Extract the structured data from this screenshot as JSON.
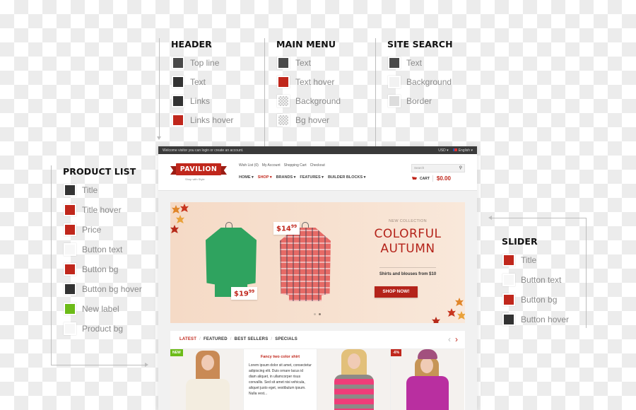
{
  "legends": {
    "header": {
      "title": "HEADER",
      "items": [
        {
          "label": "Top line",
          "color": "#4a4a4a"
        },
        {
          "label": "Text",
          "color": "#333333"
        },
        {
          "label": "Links",
          "color": "#333333"
        },
        {
          "label": "Links hover",
          "color": "#c0271c"
        }
      ]
    },
    "main_menu": {
      "title": "MAIN MENU",
      "items": [
        {
          "label": "Text",
          "color": "#4a4a4a"
        },
        {
          "label": "Text hover",
          "color": "#c0271c"
        },
        {
          "label": "Background",
          "color": "transparent"
        },
        {
          "label": "Bg hover",
          "color": "transparent"
        }
      ]
    },
    "site_search": {
      "title": "SITE SEARCH",
      "items": [
        {
          "label": "Text",
          "color": "#4a4a4a"
        },
        {
          "label": "Background",
          "color": "#f2f2f2"
        },
        {
          "label": "Border",
          "color": "#dddddd"
        }
      ]
    },
    "product_list": {
      "title": "PRODUCT LIST",
      "items": [
        {
          "label": "Title",
          "color": "#333333"
        },
        {
          "label": "Title hover",
          "color": "#c0271c"
        },
        {
          "label": "Price",
          "color": "#c0271c"
        },
        {
          "label": "Button text",
          "color": "#f7f7f7"
        },
        {
          "label": "Button bg",
          "color": "#c0271c"
        },
        {
          "label": "Button bg hover",
          "color": "#333333"
        },
        {
          "label": "New label",
          "color": "#6cbb18"
        },
        {
          "label": "Product bg",
          "color": "#f7f7f7"
        }
      ]
    },
    "slider": {
      "title": "SLIDER",
      "items": [
        {
          "label": "Title",
          "color": "#c0271c"
        },
        {
          "label": "Button text",
          "color": "#f7f7f7"
        },
        {
          "label": "Button bg",
          "color": "#c0271c"
        },
        {
          "label": "Button hover",
          "color": "#333333"
        }
      ]
    }
  },
  "site": {
    "topbar": {
      "welcome": "Welcome visitor you can login or create an account.",
      "currency": "USD ▾",
      "language": "English ▾"
    },
    "logo": {
      "name": "PAVILION",
      "tagline": "Shop with Style"
    },
    "toplinks": [
      "Wish List (0)",
      "My Account",
      "Shopping Cart",
      "Checkout"
    ],
    "menu": [
      {
        "label": "HOME ▾",
        "active": false
      },
      {
        "label": "SHOP ▾",
        "active": true
      },
      {
        "label": "BRANDS ▾",
        "active": false
      },
      {
        "label": "FEATURES ▾",
        "active": false
      },
      {
        "label": "BUILDER BLOCKS ▾",
        "active": false
      }
    ],
    "search": {
      "placeholder": "Search",
      "icon": "search-icon"
    },
    "cart": {
      "label": "CART",
      "total": "$0.00",
      "icon": "cart-icon"
    },
    "slider": {
      "price_tag_1": {
        "main": "$19",
        "cents": "99"
      },
      "price_tag_2": {
        "main": "$14",
        "cents": "99"
      },
      "subtitle": "NEW COLLECTION",
      "title_line1": "COLORFUL",
      "title_line2": "AUTUMN",
      "description": "Shirts and blouses from $10",
      "button": "SHOP NOW!",
      "slides_total": 2,
      "active_slide": 2
    },
    "products": {
      "tabs": [
        {
          "label": "LATEST",
          "active": true
        },
        {
          "label": "FEATURED",
          "active": false
        },
        {
          "label": "BEST SELLERS",
          "active": false
        },
        {
          "label": "SPECIALS",
          "active": false
        }
      ],
      "prev_icon": "‹",
      "next_icon": "›",
      "new_badge": "NEW",
      "sale_badge": "-6%",
      "featured_title": "Fancy two color shirt",
      "featured_text": "Lorem ipsum dolor sit amet, consectetur adipiscing elit. Duis ornare lacus id diam aliquet, in ullamcorper risus convallis. Sed sit amet nisi vehicula, aliquet justo eget, vestibulum ipsum. Nulla vest..."
    }
  }
}
